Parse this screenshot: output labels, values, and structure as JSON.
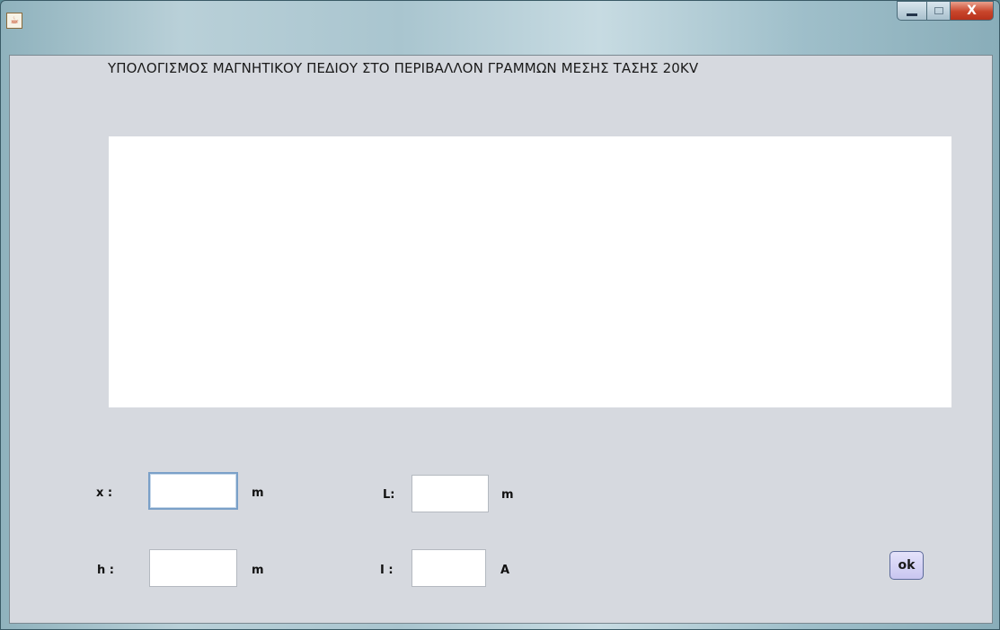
{
  "window": {
    "icon": "java-cup-icon",
    "controls": {
      "minimize": "minimize-icon",
      "maximize": "maximize-icon",
      "close": "X"
    }
  },
  "heading": "ΥΠΟΛΟΓΙΣΜΟΣ ΜΑΓΝΗΤΙΚΟΥ ΠΕΔΙΟΥ ΣΤΟ ΠΕΡΙΒΑΛΛΟΝ ΓΡΑΜΜΩΝ ΜΕΣΗΣ ΤΑΣΗΣ 20KV",
  "fields": {
    "x": {
      "label": "x :",
      "value": "",
      "unit": "m"
    },
    "h": {
      "label": "h :",
      "value": "",
      "unit": "m"
    },
    "L": {
      "label": "L:",
      "value": "",
      "unit": "m"
    },
    "I": {
      "label": "I :",
      "value": "",
      "unit": "A"
    }
  },
  "ok_button": {
    "label": "ok"
  },
  "colors": {
    "client_background": "#d6d9df",
    "ok_button": "#c9c6f0",
    "focus_border": "#7aa0c8"
  }
}
